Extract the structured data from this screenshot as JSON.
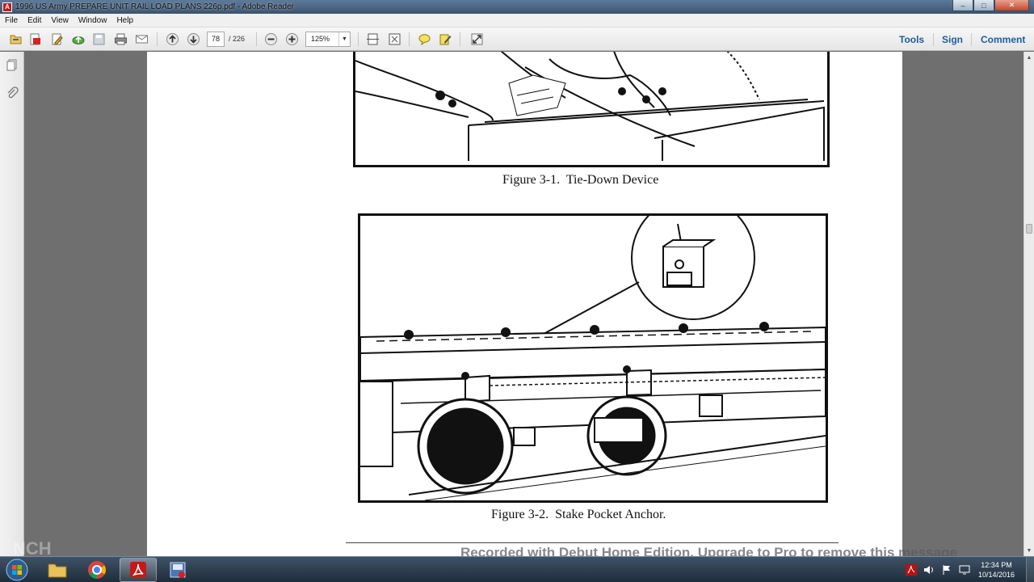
{
  "window": {
    "title": "1996 US Army PREPARE UNIT RAIL LOAD PLANS 226p.pdf - Adobe Reader",
    "minimize": "–",
    "maximize": "□",
    "close": "✕"
  },
  "menu": [
    "File",
    "Edit",
    "View",
    "Window",
    "Help"
  ],
  "toolbar": {
    "current_page": "78",
    "total_pages": "/ 226",
    "zoom": "125%",
    "links": [
      "Tools",
      "Sign",
      "Comment"
    ]
  },
  "document": {
    "figure1_caption": "Figure 3-1.  Tie-Down Device",
    "figure2_caption": "Figure 3-2.  Stake Pocket Anchor."
  },
  "watermark": "Recorded with Debut Home Edition. Upgrade to Pro to remove this message",
  "taskbar": {
    "time": "12:34 PM",
    "date": "10/14/2016"
  },
  "colors": {
    "link_blue": "#1f5d9c",
    "doc_background": "#6f6f6f",
    "taskbar": "#2b3a4a"
  }
}
